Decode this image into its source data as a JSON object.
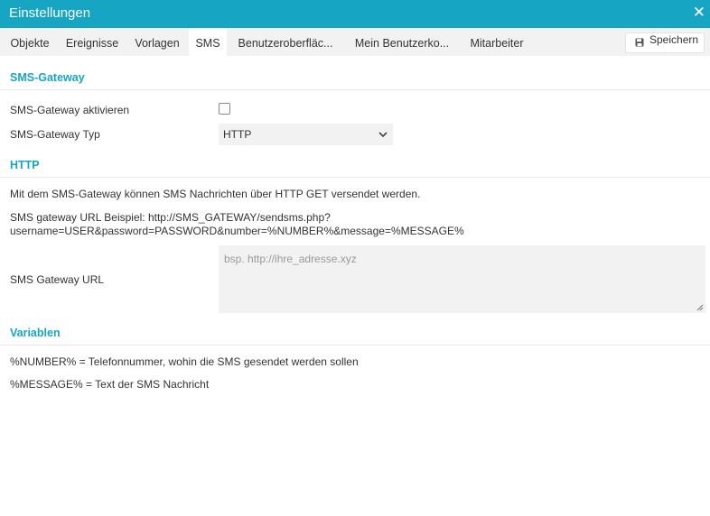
{
  "window": {
    "title": "Einstellungen"
  },
  "tabs": [
    {
      "label": "Objekte"
    },
    {
      "label": "Ereignisse"
    },
    {
      "label": "Vorlagen"
    },
    {
      "label": "SMS"
    },
    {
      "label": "Benutzeroberfläc..."
    },
    {
      "label": "Mein Benutzerko..."
    },
    {
      "label": "Mitarbeiter"
    }
  ],
  "active_tab": "SMS",
  "toolbar": {
    "save_label": "Speichern"
  },
  "sms_gateway": {
    "section_title": "SMS-Gateway",
    "activate_label": "SMS-Gateway aktivieren",
    "activate_checked": false,
    "type_label": "SMS-Gateway Typ",
    "type_value": "HTTP"
  },
  "http": {
    "section_title": "HTTP",
    "description": "Mit dem SMS-Gateway können SMS Nachrichten über HTTP GET versendet werden.",
    "example_line1": "SMS gateway URL Beispiel: http://SMS_GATEWAY/sendsms.php?",
    "example_line2": "username=USER&password=PASSWORD&number=%NUMBER%&message=%MESSAGE%",
    "url_label": "SMS Gateway URL",
    "url_value": "",
    "url_placeholder": "bsp. http://ihre_adresse.xyz"
  },
  "variables": {
    "section_title": "Variablen",
    "number": "%NUMBER% = Telefonnummer, wohin die SMS gesendet werden sollen",
    "message": "%MESSAGE% = Text der SMS Nachricht"
  },
  "colors": {
    "accent": "#17a5c4",
    "tabbar_bg": "#f2f2f2",
    "input_bg": "#f2f2f2"
  },
  "icons": {
    "close": "close-icon",
    "save": "floppy-disk-icon",
    "dropdown": "chevron-down-icon"
  }
}
